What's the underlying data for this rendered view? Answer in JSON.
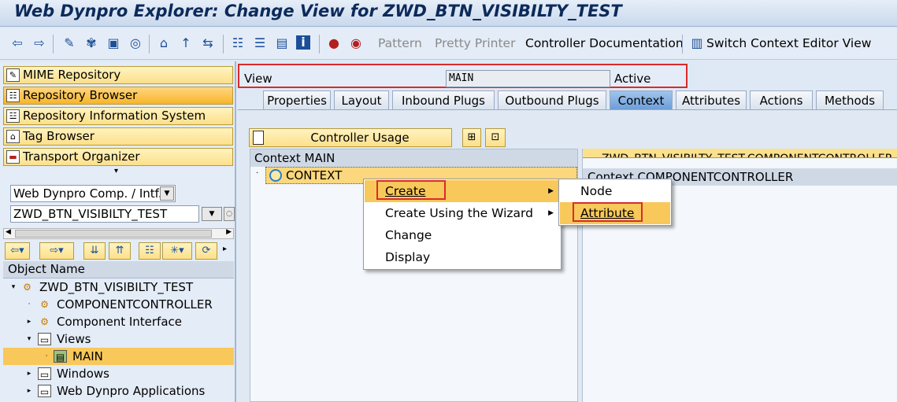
{
  "window": {
    "title": "Web Dynpro Explorer: Change View for ZWD_BTN_VISIBILTY_TEST"
  },
  "toolbar": {
    "icons": [
      "back-arrow-icon",
      "forward-arrow-icon",
      "edit-pencil-icon",
      "objects-icon",
      "check-icon",
      "activate-icon",
      "other-object-icon",
      "tree-icon",
      "insert-icon",
      "hierarchy-icon",
      "stack-icon",
      "display-list-icon",
      "info-icon",
      "breakpoint-icon",
      "watchpoint-icon"
    ],
    "pattern": "Pattern",
    "pretty_printer": "Pretty Printer",
    "controller_documentation": "Controller Documentation",
    "switch_context": "Switch Context Editor View"
  },
  "left_nav": {
    "buttons": [
      {
        "label": "MIME Repository",
        "icon": "mime-icon"
      },
      {
        "label": "Repository Browser",
        "icon": "repository-icon"
      },
      {
        "label": "Repository Information System",
        "icon": "info-system-icon"
      },
      {
        "label": "Tag Browser",
        "icon": "tag-icon"
      },
      {
        "label": "Transport Organizer",
        "icon": "truck-icon"
      }
    ],
    "object_type": "Web Dynpro Comp. / Intf.",
    "object_name": "ZWD_BTN_VISIBILTY_TEST",
    "tree_header": "Object Name",
    "tree": [
      {
        "label": "ZWD_BTN_VISIBILTY_TEST",
        "expander": "▾",
        "icon": "component-icon"
      },
      {
        "label": "COMPONENTCONTROLLER",
        "expander": "·",
        "icon": "controller-icon"
      },
      {
        "label": "Component Interface",
        "expander": "▸",
        "icon": "interface-icon"
      },
      {
        "label": "Views",
        "expander": "▾",
        "icon": "folder-icon"
      },
      {
        "label": "MAIN",
        "expander": "·",
        "icon": "view-icon"
      },
      {
        "label": "Windows",
        "expander": "▸",
        "icon": "window-icon"
      },
      {
        "label": "Web Dynpro Applications",
        "expander": "▸",
        "icon": "application-icon"
      }
    ]
  },
  "view_header": {
    "view_label": "View",
    "view_value": "MAIN",
    "status": "Active"
  },
  "tabs": [
    "Properties",
    "Layout",
    "Inbound Plugs",
    "Outbound Plugs",
    "Context",
    "Attributes",
    "Actions",
    "Methods"
  ],
  "active_tab": "Context",
  "context": {
    "controller_usage": "Controller Usage",
    "left_header": "Context MAIN",
    "root_node": "CONTEXT",
    "right_topline": "ZWD_BTN_VISIBILTY_TEST.COMPONENTCONTROLLER",
    "right_header": "Context COMPONENTCONTROLLER"
  },
  "context_menu": {
    "items": [
      "Create",
      "Create Using the Wizard",
      "Change",
      "Display"
    ],
    "underline_first": [
      "C",
      "C",
      "C",
      "D"
    ]
  },
  "submenu": {
    "items": [
      "Node",
      "Attribute"
    ]
  },
  "colors": {
    "highlight": "#f8c85a",
    "annotation_red": "#d92b2b",
    "active_tab": "#7aa8de"
  }
}
